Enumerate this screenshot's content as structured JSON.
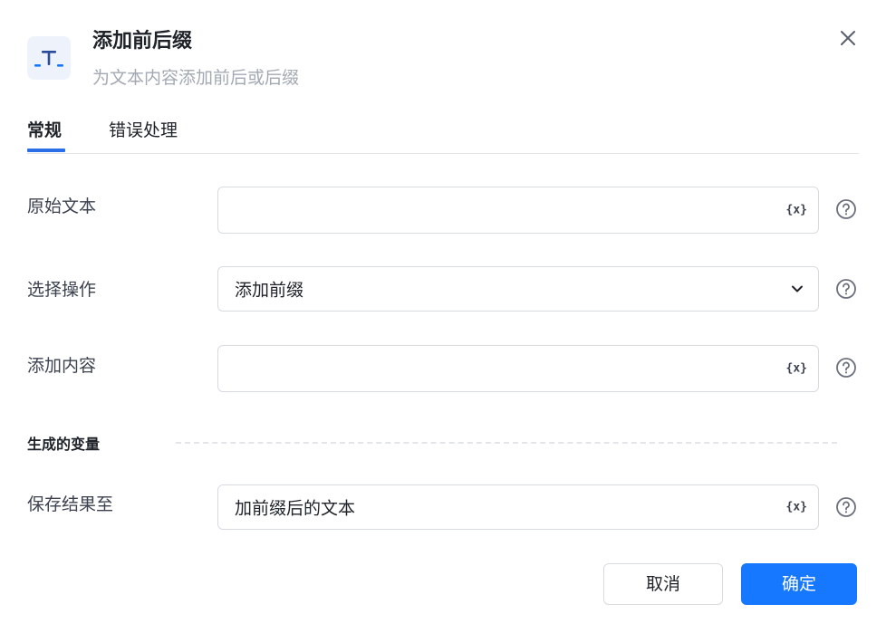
{
  "dialog": {
    "title": "添加前后缀",
    "subtitle": "为文本内容添加前后或后缀",
    "icon": "text-affix-icon",
    "accent_color": "#1677ff"
  },
  "tabs": [
    {
      "label": "常规",
      "active": true
    },
    {
      "label": "错误处理",
      "active": false
    }
  ],
  "form": {
    "original_text": {
      "label": "原始文本",
      "value": "",
      "var_icon_text": "{x}"
    },
    "operation": {
      "label": "选择操作",
      "value": "添加前缀"
    },
    "add_content": {
      "label": "添加内容",
      "value": "",
      "var_icon_text": "{x}"
    }
  },
  "output": {
    "section_title": "生成的变量",
    "save_to": {
      "label": "保存结果至",
      "value": "加前缀后的文本",
      "var_icon_text": "{x}"
    }
  },
  "footer": {
    "cancel_label": "取消",
    "ok_label": "确定"
  }
}
